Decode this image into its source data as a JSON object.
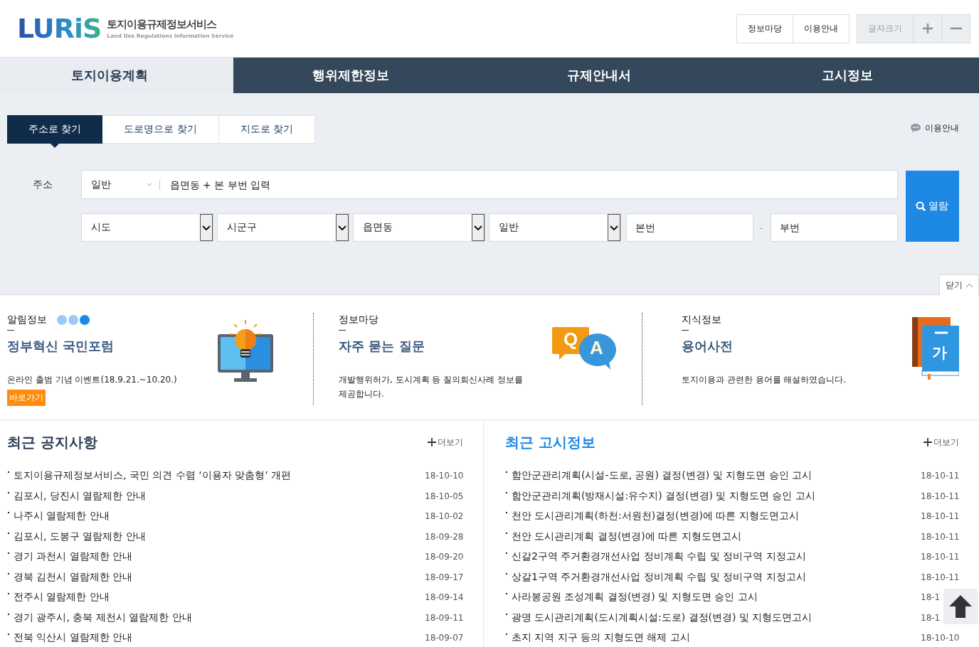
{
  "header": {
    "logo": "LURiS",
    "site_name": "토지이용규제정보서비스",
    "site_name_en": "Land Use Regulations Information Service",
    "links": [
      "정보마당",
      "이용안내"
    ],
    "font_size_label": "글자크기"
  },
  "nav": [
    {
      "label": "토지이용계획",
      "selected": true
    },
    {
      "label": "행위제한정보",
      "selected": false
    },
    {
      "label": "규제안내서",
      "selected": false
    },
    {
      "label": "고시정보",
      "selected": false
    }
  ],
  "search": {
    "tabs": [
      {
        "label": "주소로 찾기",
        "selected": true
      },
      {
        "label": "도로명으로 찾기",
        "selected": false
      },
      {
        "label": "지도로 찾기",
        "selected": false
      }
    ],
    "help": "이용안내",
    "address_label": "주소",
    "type_select": "일반",
    "query_placeholder": "읍면동 + 본 부번 입력",
    "selects": [
      "시도",
      "시군구",
      "읍면동",
      "일반"
    ],
    "main_number_placeholder": "본번",
    "separator": "-",
    "sub_number_placeholder": "부번",
    "submit": "열람",
    "close": "닫기"
  },
  "info": [
    {
      "kind": "notice",
      "heading": "알림정보",
      "pager": [
        {
          "selected": false
        },
        {
          "selected": false
        },
        {
          "selected": true
        }
      ],
      "title": "정부혁신 국민포럼",
      "text": "온라인 출범 기념 이벤트(18.9.21.~10.20.)",
      "link": "바로가기"
    },
    {
      "kind": "qa",
      "heading": "정보마당",
      "icon_letters": [
        "Q",
        "A"
      ],
      "title": "자주 묻는 질문",
      "text": "개발행위허가, 도시계획 등 질의회신사례 정보를 제공합니다."
    },
    {
      "kind": "dictionary",
      "heading": "지식정보",
      "icon_letters": [
        "가"
      ],
      "title": "용어사전",
      "text": "토지이용과 관련한 용어를 해설하였습니다."
    }
  ],
  "boards": [
    {
      "title": "최근 공지사항",
      "active": false,
      "more": "더보기",
      "items": [
        {
          "title": "토지이용규제정보서비스, 국민 의견 수렴 ‘이용자 맞춤형’ 개편",
          "date": "18-10-10"
        },
        {
          "title": "김포시, 당진시 열람제한 안내",
          "date": "18-10-05"
        },
        {
          "title": "나주시 열람제한 안내",
          "date": "18-10-02"
        },
        {
          "title": "김포시, 도봉구 열람제한 안내",
          "date": "18-09-28"
        },
        {
          "title": "경기 과천시 열람제한 안내",
          "date": "18-09-20"
        },
        {
          "title": "경북 김천시 열람제한 안내",
          "date": "18-09-17"
        },
        {
          "title": "전주시 열람제한 안내",
          "date": "18-09-14"
        },
        {
          "title": "경기 광주시, 충북 제천시 열람제한 안내",
          "date": "18-09-11"
        },
        {
          "title": "전북 익산시 열람제한 안내",
          "date": "18-09-07"
        }
      ]
    },
    {
      "title": "최근 고시정보",
      "active": true,
      "more": "더보기",
      "items": [
        {
          "title": "함안군관리계획(시설-도로, 공원) 결정(변경) 및 지형도면 승인 고시",
          "date": "18-10-11"
        },
        {
          "title": "함안군관리계획(방재시설:유수지) 결정(변경) 및 지형도면 승인 고시",
          "date": "18-10-11"
        },
        {
          "title": "천안 도시관리계획(하천:서원천)결정(변경)에 따른 지형도면고시",
          "date": "18-10-11"
        },
        {
          "title": "천안 도시관리계획 결정(변경)에 따른 지형도면고시",
          "date": "18-10-11"
        },
        {
          "title": "신갈2구역 주거환경개선사업 정비계획 수립 및 정비구역 지정고시",
          "date": "18-10-11"
        },
        {
          "title": "상갈1구역 주거환경개선사업 정비계획 수립 및 정비구역 지정고시",
          "date": "18-10-11"
        },
        {
          "title": "사라봉공원 조성계획 결정(변경) 및 지형도면 승인 고시",
          "date": "18-1"
        },
        {
          "title": "광명 도시관리계획(도시계획시설:도로) 결정(변경) 및 지형도면고시",
          "date": "18-1"
        },
        {
          "title": "초지 지역 지구 등의 지형도면 해제 고시",
          "date": "18-10-10"
        }
      ]
    }
  ]
}
